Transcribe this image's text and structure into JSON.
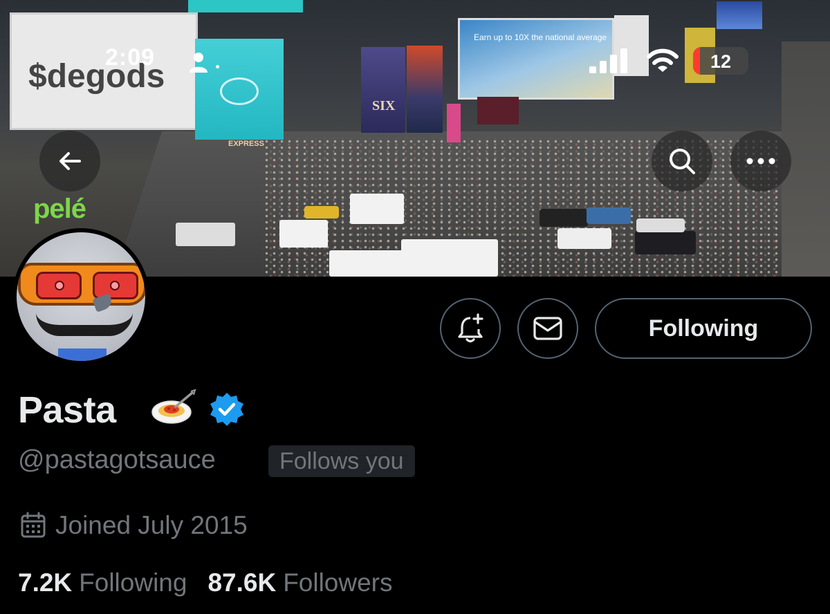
{
  "status_bar": {
    "time": "2:09",
    "battery_level": "12",
    "battery_fraction": 0.12,
    "icons": [
      "person-icon",
      "signal-icon",
      "wifi-icon",
      "battery-icon"
    ]
  },
  "banner": {
    "billboard_text": "$degods",
    "express_sign": "EXPRESS",
    "pele_sign": "pelé",
    "ad_text": "Earn up to 10X the national average",
    "six_sign": "SIX"
  },
  "profile": {
    "display_name": "Pasta",
    "name_emoji": "spaghetti",
    "handle": "@pastagotsauce",
    "follows_you_label": "Follows you",
    "joined": "Joined July 2015",
    "following_count": "7.2K",
    "following_label": "Following",
    "followers_count": "87.6K",
    "followers_label": "Followers",
    "verified": true
  },
  "actions": {
    "following_button_label": "Following",
    "notify_icon": "bell-plus-icon",
    "message_icon": "envelope-icon"
  },
  "colors": {
    "background": "#000000",
    "primary_text": "#e7e9ea",
    "secondary_text": "#71767b",
    "border": "#536471",
    "verified_blue": "#1d9bf0",
    "battery_red": "#ff3b30"
  }
}
